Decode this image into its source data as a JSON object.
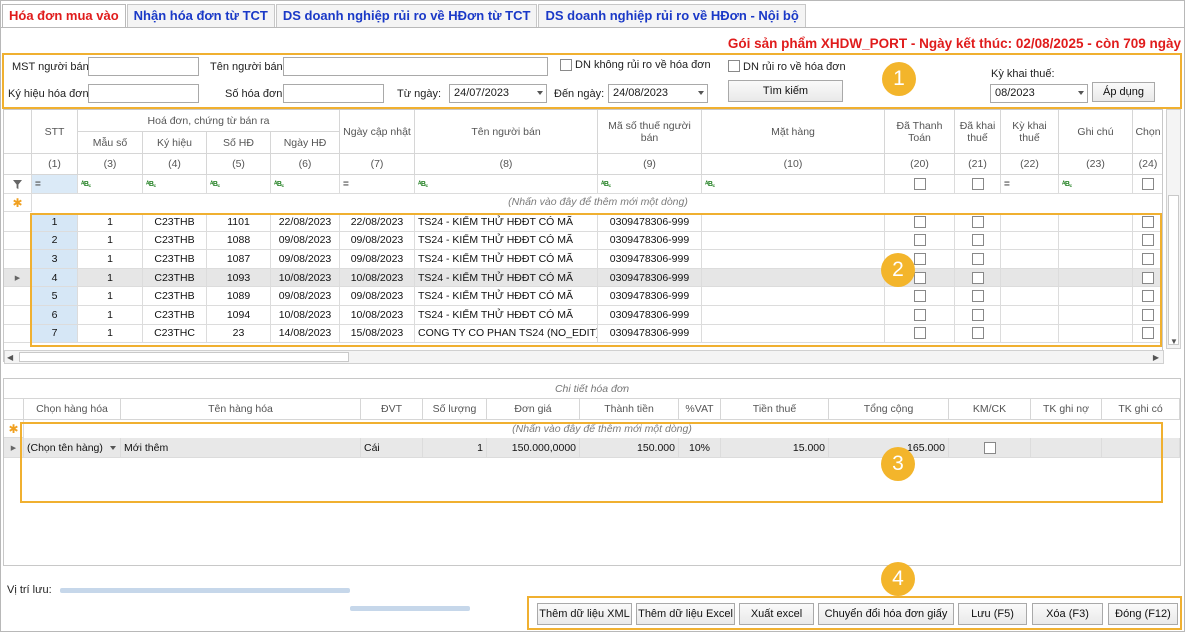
{
  "tabs": [
    {
      "label": "Hóa đơn mua vào"
    },
    {
      "label": "Nhận hóa đơn từ TCT"
    },
    {
      "label": "DS doanh nghiệp rủi ro về HĐơn từ TCT"
    },
    {
      "label": "DS doanh nghiệp rủi ro về HĐơn - Nội bộ"
    }
  ],
  "product_info": "Gói sản phẩm XHDW_PORT - Ngày kết thúc: 02/08/2025 - còn 709 ngày",
  "filter": {
    "mst_label": "MST người bán:",
    "mst_value": "",
    "ten_label": "Tên người bán:",
    "ten_value": "",
    "kyhieu_label": "Ký hiệu hóa đơn:",
    "kyhieu_value": "",
    "sohd_label": "Số hóa đơn:",
    "sohd_value": "",
    "dn_khong_ruiro_label": "DN không rủi ro về hóa đơn",
    "dn_ruiro_label": "DN rủi ro về hóa đơn",
    "tu_ngay_label": "Từ ngày:",
    "tu_ngay_value": "24/07/2023",
    "den_ngay_label": "Đến ngày:",
    "den_ngay_value": "24/08/2023",
    "tim_kiem_label": "Tìm kiếm",
    "ky_khai_label": "Kỳ khai thuế:",
    "ky_khai_value": "08/2023",
    "ap_dung_label": "Áp dụng"
  },
  "badges": {
    "b1": "1",
    "b2": "2",
    "b3": "3",
    "b4": "4"
  },
  "grid": {
    "group_header": "Hoá đơn, chứng từ bán ra",
    "columns": {
      "stt": "STT",
      "mauso": "Mẫu số",
      "kyhieu": "Ký hiệu",
      "sohd": "Số HĐ",
      "ngayhd": "Ngày HĐ",
      "ngaycapnhat": "Ngày cập nhật",
      "tennguoiban": "Tên người bán",
      "mst": "Mã số thuế người bán",
      "mathang": "Mặt hàng",
      "dathanhtoan": "Đã Thanh Toán",
      "dakhaithue": "Đã khai thuế",
      "kykhaithue": "Kỳ khai thuế",
      "ghichu": "Ghi chú",
      "chon": "Chọn"
    },
    "col_numbers": {
      "stt": "(1)",
      "mauso": "(3)",
      "kyhieu": "(4)",
      "sohd": "(5)",
      "ngayhd": "(6)",
      "ngaycapnhat": "(7)",
      "tennguoiban": "(8)",
      "mst": "(9)",
      "mathang": "(10)",
      "dathanhtoan": "(20)",
      "dakhaithue": "(21)",
      "kykhaithue": "(22)",
      "ghichu": "(23)",
      "chon": "(24)"
    },
    "filter_eq": "=",
    "filter_abc": "ᴬB꜀",
    "add_row_hint": "(Nhấn vào đây để thêm mới một dòng)",
    "rows": [
      {
        "stt": "1",
        "mauso": "1",
        "kyhieu": "C23THB",
        "sohd": "1101",
        "ngayhd": "22/08/2023",
        "ngaycapnhat": "22/08/2023",
        "ten": "TS24 - KIỂM THỬ HĐĐT CÓ MÃ",
        "mst": "0309478306-999"
      },
      {
        "stt": "2",
        "mauso": "1",
        "kyhieu": "C23THB",
        "sohd": "1088",
        "ngayhd": "09/08/2023",
        "ngaycapnhat": "09/08/2023",
        "ten": "TS24 - KIỂM THỬ HĐĐT CÓ MÃ",
        "mst": "0309478306-999"
      },
      {
        "stt": "3",
        "mauso": "1",
        "kyhieu": "C23THB",
        "sohd": "1087",
        "ngayhd": "09/08/2023",
        "ngaycapnhat": "09/08/2023",
        "ten": "TS24 - KIỂM THỬ HĐĐT CÓ MÃ",
        "mst": "0309478306-999"
      },
      {
        "stt": "4",
        "mauso": "1",
        "kyhieu": "C23THB",
        "sohd": "1093",
        "ngayhd": "10/08/2023",
        "ngaycapnhat": "10/08/2023",
        "ten": "TS24 - KIỂM THỬ HĐĐT CÓ MÃ",
        "mst": "0309478306-999"
      },
      {
        "stt": "5",
        "mauso": "1",
        "kyhieu": "C23THB",
        "sohd": "1089",
        "ngayhd": "09/08/2023",
        "ngaycapnhat": "09/08/2023",
        "ten": "TS24 - KIỂM THỬ HĐĐT CÓ MÃ",
        "mst": "0309478306-999"
      },
      {
        "stt": "6",
        "mauso": "1",
        "kyhieu": "C23THB",
        "sohd": "1094",
        "ngayhd": "10/08/2023",
        "ngaycapnhat": "10/08/2023",
        "ten": "TS24 - KIỂM THỬ HĐĐT CÓ MÃ",
        "mst": "0309478306-999"
      },
      {
        "stt": "7",
        "mauso": "1",
        "kyhieu": "C23THC",
        "sohd": "23",
        "ngayhd": "14/08/2023",
        "ngaycapnhat": "15/08/2023",
        "ten": "CONG TY CO PHAN TS24 (NO_EDIT)",
        "mst": "0309478306-999"
      }
    ]
  },
  "detail": {
    "title": "Chi tiết hóa đơn",
    "columns": {
      "chon_hang": "Chọn hàng hóa",
      "ten_hang": "Tên hàng hóa",
      "dvt": "ĐVT",
      "so_luong": "Số lượng",
      "don_gia": "Đơn giá",
      "thanh_tien": "Thành tiền",
      "vat": "%VAT",
      "tien_thue": "Tiền thuế",
      "tong_cong": "Tổng cộng",
      "kmck": "KM/CK",
      "tk_no": "TK ghi nợ",
      "tk_co": "TK ghi có"
    },
    "add_row_hint": "(Nhấn vào đây để thêm mới một dòng)",
    "row": {
      "chon_hang": "(Chọn tên hàng)",
      "ten_hang": "Mới thêm",
      "dvt": "Cái",
      "so_luong": "1",
      "don_gia": "150.000,0000",
      "thanh_tien": "150.000",
      "vat": "10%",
      "tien_thue": "15.000",
      "tong_cong": "165.000"
    }
  },
  "footer": {
    "vi_tri_luu_label": "Vị trí lưu:",
    "buttons": [
      "Thêm dữ liệu XML",
      "Thêm dữ liệu Excel",
      "Xuất excel",
      "Chuyển đổi hóa đơn giấy",
      "Lưu (F5)",
      "Xóa (F3)",
      "Đóng (F12)"
    ]
  },
  "colors": {
    "accent_orange": "#f3b52b",
    "tab_active": "#e01c1c",
    "tab_link": "#1a39c7"
  }
}
